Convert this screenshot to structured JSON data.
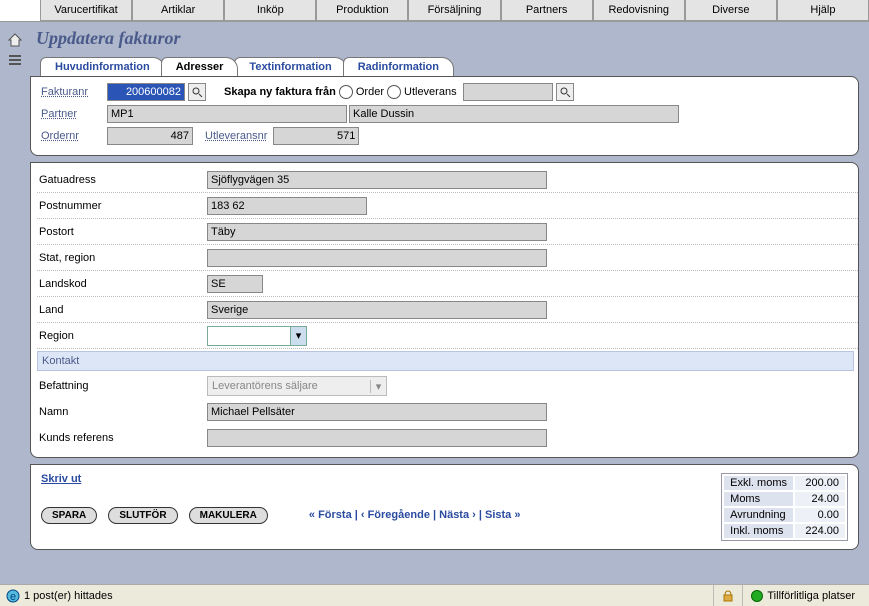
{
  "topnav": [
    "Varucertifikat",
    "Artiklar",
    "Inköp",
    "Produktion",
    "Försäljning",
    "Partners",
    "Redovisning",
    "Diverse",
    "Hjälp"
  ],
  "page_title": "Uppdatera fakturor",
  "tabs": [
    "Huvudinformation",
    "Adresser",
    "Textinformation",
    "Radinformation"
  ],
  "active_tab": 1,
  "header": {
    "fakturanr_label": "Fakturanr",
    "fakturanr": "200600082",
    "skapa_label": "Skapa ny faktura från",
    "order_label": "Order",
    "utleverans_label": "Utleverans",
    "utleverans_value": "",
    "partner_label": "Partner",
    "partner_code": "MP1",
    "partner_name": "Kalle Dussin",
    "ordernr_label": "Ordernr",
    "ordernr": "487",
    "utleveransnr_label": "Utleveransnr",
    "utleveransnr": "571"
  },
  "address": {
    "gatuadress_label": "Gatuadress",
    "gatuadress": "Sjöflygvägen 35",
    "postnummer_label": "Postnummer",
    "postnummer": "183 62",
    "postort_label": "Postort",
    "postort": "Täby",
    "stat_label": "Stat, region",
    "stat": "",
    "landskod_label": "Landskod",
    "landskod": "SE",
    "land_label": "Land",
    "land": "Sverige",
    "region_label": "Region",
    "region": ""
  },
  "kontakt": {
    "section": "Kontakt",
    "befattning_label": "Befattning",
    "befattning": "Leverantörens säljare",
    "namn_label": "Namn",
    "namn": "Michael Pellsäter",
    "kundref_label": "Kunds referens",
    "kundref": ""
  },
  "footer": {
    "skriv_ut": "Skriv ut",
    "spara": "SPARA",
    "slutfor": "SLUTFÖR",
    "makulera": "MAKULERA",
    "nav": "«  Första  |  ‹  Föregående  |  Nästa  ›  |  Sista  »",
    "totals": [
      {
        "label": "Exkl. moms",
        "value": "200.00"
      },
      {
        "label": "Moms",
        "value": "24.00"
      },
      {
        "label": "Avrundning",
        "value": "0.00"
      },
      {
        "label": "Inkl. moms",
        "value": "224.00"
      }
    ]
  },
  "status": {
    "left": "1 post(er) hittades",
    "right": "Tillförlitliga platser"
  }
}
